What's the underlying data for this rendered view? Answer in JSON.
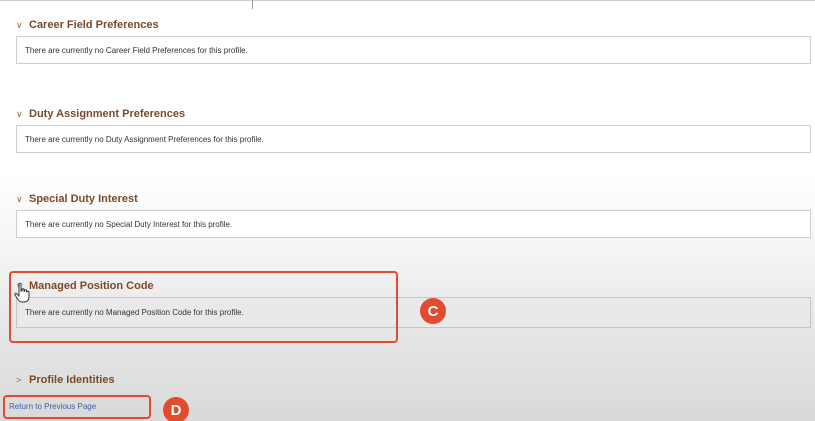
{
  "sections": [
    {
      "title": "Career Field Preferences",
      "message": "There are currently no Career Field Preferences for this profile.",
      "expanded": true
    },
    {
      "title": "Duty Assignment Preferences",
      "message": "There are currently no Duty Assignment Preferences for this profile.",
      "expanded": true
    },
    {
      "title": "Special Duty Interest",
      "message": "There are currently no Special Duty Interest for this profile.",
      "expanded": true
    },
    {
      "title": "Managed Position Code",
      "message": "There are currently no Managed Position Code for this profile.",
      "expanded": true
    },
    {
      "title": "Profile Identities",
      "expanded": false
    }
  ],
  "icons": {
    "expanded": "chevron-down-icon",
    "collapsed": "chevron-right-icon",
    "cursor": "hand-pointer-icon"
  },
  "return_link": "Return to Previous Page",
  "callouts": {
    "c": "C",
    "d": "D"
  },
  "colors": {
    "section_title": "#7a4a2a",
    "callout": "#e34a2e",
    "link": "#3b5fa6"
  }
}
